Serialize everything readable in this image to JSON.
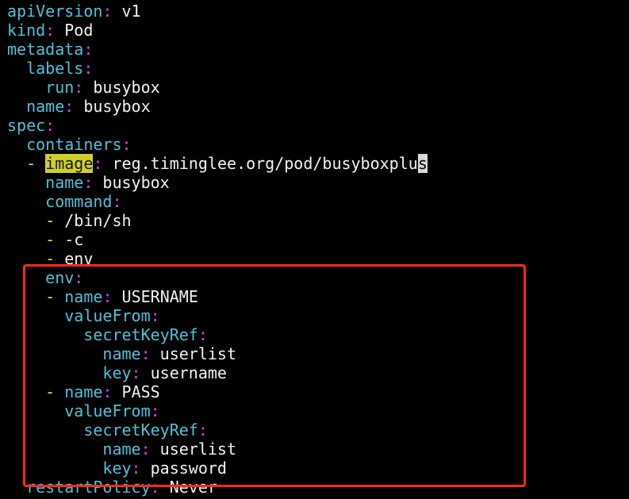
{
  "editor": {
    "colors": {
      "background": "#000000",
      "key": "#4fc1d6",
      "colon": "#e040e0",
      "value": "#f2f2f2",
      "dash": "#e3e34a",
      "search_highlight": "#cfcf2e",
      "cursor": "#d9d9d9",
      "annotation_box": "#ff2a1a"
    },
    "lines": [
      [
        {
          "t": "apiVersion",
          "k": "key"
        },
        {
          "t": ":",
          "k": "colon"
        },
        {
          "t": " v1",
          "k": "val"
        }
      ],
      [
        {
          "t": "kind",
          "k": "key"
        },
        {
          "t": ":",
          "k": "colon"
        },
        {
          "t": " Pod",
          "k": "val"
        }
      ],
      [
        {
          "t": "metadata",
          "k": "key"
        },
        {
          "t": ":",
          "k": "colon"
        }
      ],
      [
        {
          "t": "  ",
          "k": "val"
        },
        {
          "t": "labels",
          "k": "key"
        },
        {
          "t": ":",
          "k": "colon"
        }
      ],
      [
        {
          "t": "    ",
          "k": "val"
        },
        {
          "t": "run",
          "k": "key"
        },
        {
          "t": ":",
          "k": "colon"
        },
        {
          "t": " busybox",
          "k": "val"
        }
      ],
      [
        {
          "t": "  ",
          "k": "val"
        },
        {
          "t": "name",
          "k": "key"
        },
        {
          "t": ":",
          "k": "colon"
        },
        {
          "t": " busybox",
          "k": "val"
        }
      ],
      [
        {
          "t": "spec",
          "k": "key"
        },
        {
          "t": ":",
          "k": "colon"
        }
      ],
      [
        {
          "t": "  ",
          "k": "val"
        },
        {
          "t": "containers",
          "k": "key"
        },
        {
          "t": ":",
          "k": "colon"
        }
      ],
      [
        {
          "t": "  ",
          "k": "val"
        },
        {
          "t": "-",
          "k": "dash"
        },
        {
          "t": " ",
          "k": "val"
        },
        {
          "t": "image",
          "k": "hl"
        },
        {
          "t": ":",
          "k": "colon"
        },
        {
          "t": " reg.timinglee.org/pod/busyboxplu",
          "k": "val"
        },
        {
          "t": "s",
          "k": "cursor"
        }
      ],
      [
        {
          "t": "    ",
          "k": "val"
        },
        {
          "t": "name",
          "k": "key"
        },
        {
          "t": ":",
          "k": "colon"
        },
        {
          "t": " busybox",
          "k": "val"
        }
      ],
      [
        {
          "t": "    ",
          "k": "val"
        },
        {
          "t": "command",
          "k": "key"
        },
        {
          "t": ":",
          "k": "colon"
        }
      ],
      [
        {
          "t": "    ",
          "k": "val"
        },
        {
          "t": "-",
          "k": "dash"
        },
        {
          "t": " /bin/sh",
          "k": "val"
        }
      ],
      [
        {
          "t": "    ",
          "k": "val"
        },
        {
          "t": "-",
          "k": "dash"
        },
        {
          "t": " -c",
          "k": "val"
        }
      ],
      [
        {
          "t": "    ",
          "k": "val"
        },
        {
          "t": "-",
          "k": "dash"
        },
        {
          "t": " env",
          "k": "val"
        }
      ],
      [
        {
          "t": "    ",
          "k": "val"
        },
        {
          "t": "env",
          "k": "key"
        },
        {
          "t": ":",
          "k": "colon"
        }
      ],
      [
        {
          "t": "    ",
          "k": "val"
        },
        {
          "t": "-",
          "k": "dash"
        },
        {
          "t": " ",
          "k": "val"
        },
        {
          "t": "name",
          "k": "key"
        },
        {
          "t": ":",
          "k": "colon"
        },
        {
          "t": " USERNAME",
          "k": "val"
        }
      ],
      [
        {
          "t": "      ",
          "k": "val"
        },
        {
          "t": "valueFrom",
          "k": "key"
        },
        {
          "t": ":",
          "k": "colon"
        }
      ],
      [
        {
          "t": "        ",
          "k": "val"
        },
        {
          "t": "secretKeyRef",
          "k": "key"
        },
        {
          "t": ":",
          "k": "colon"
        }
      ],
      [
        {
          "t": "          ",
          "k": "val"
        },
        {
          "t": "name",
          "k": "key"
        },
        {
          "t": ":",
          "k": "colon"
        },
        {
          "t": " userlist",
          "k": "val"
        }
      ],
      [
        {
          "t": "          ",
          "k": "val"
        },
        {
          "t": "key",
          "k": "key"
        },
        {
          "t": ":",
          "k": "colon"
        },
        {
          "t": " username",
          "k": "val"
        }
      ],
      [
        {
          "t": "    ",
          "k": "val"
        },
        {
          "t": "-",
          "k": "dash"
        },
        {
          "t": " ",
          "k": "val"
        },
        {
          "t": "name",
          "k": "key"
        },
        {
          "t": ":",
          "k": "colon"
        },
        {
          "t": " PASS",
          "k": "val"
        }
      ],
      [
        {
          "t": "      ",
          "k": "val"
        },
        {
          "t": "valueFrom",
          "k": "key"
        },
        {
          "t": ":",
          "k": "colon"
        }
      ],
      [
        {
          "t": "        ",
          "k": "val"
        },
        {
          "t": "secretKeyRef",
          "k": "key"
        },
        {
          "t": ":",
          "k": "colon"
        }
      ],
      [
        {
          "t": "          ",
          "k": "val"
        },
        {
          "t": "name",
          "k": "key"
        },
        {
          "t": ":",
          "k": "colon"
        },
        {
          "t": " userlist",
          "k": "val"
        }
      ],
      [
        {
          "t": "          ",
          "k": "val"
        },
        {
          "t": "key",
          "k": "key"
        },
        {
          "t": ":",
          "k": "colon"
        },
        {
          "t": " password",
          "k": "val"
        }
      ],
      [
        {
          "t": "  ",
          "k": "val"
        },
        {
          "t": "restartPolicy",
          "k": "key"
        },
        {
          "t": ":",
          "k": "colon"
        },
        {
          "t": " Never",
          "k": "val"
        }
      ]
    ]
  }
}
